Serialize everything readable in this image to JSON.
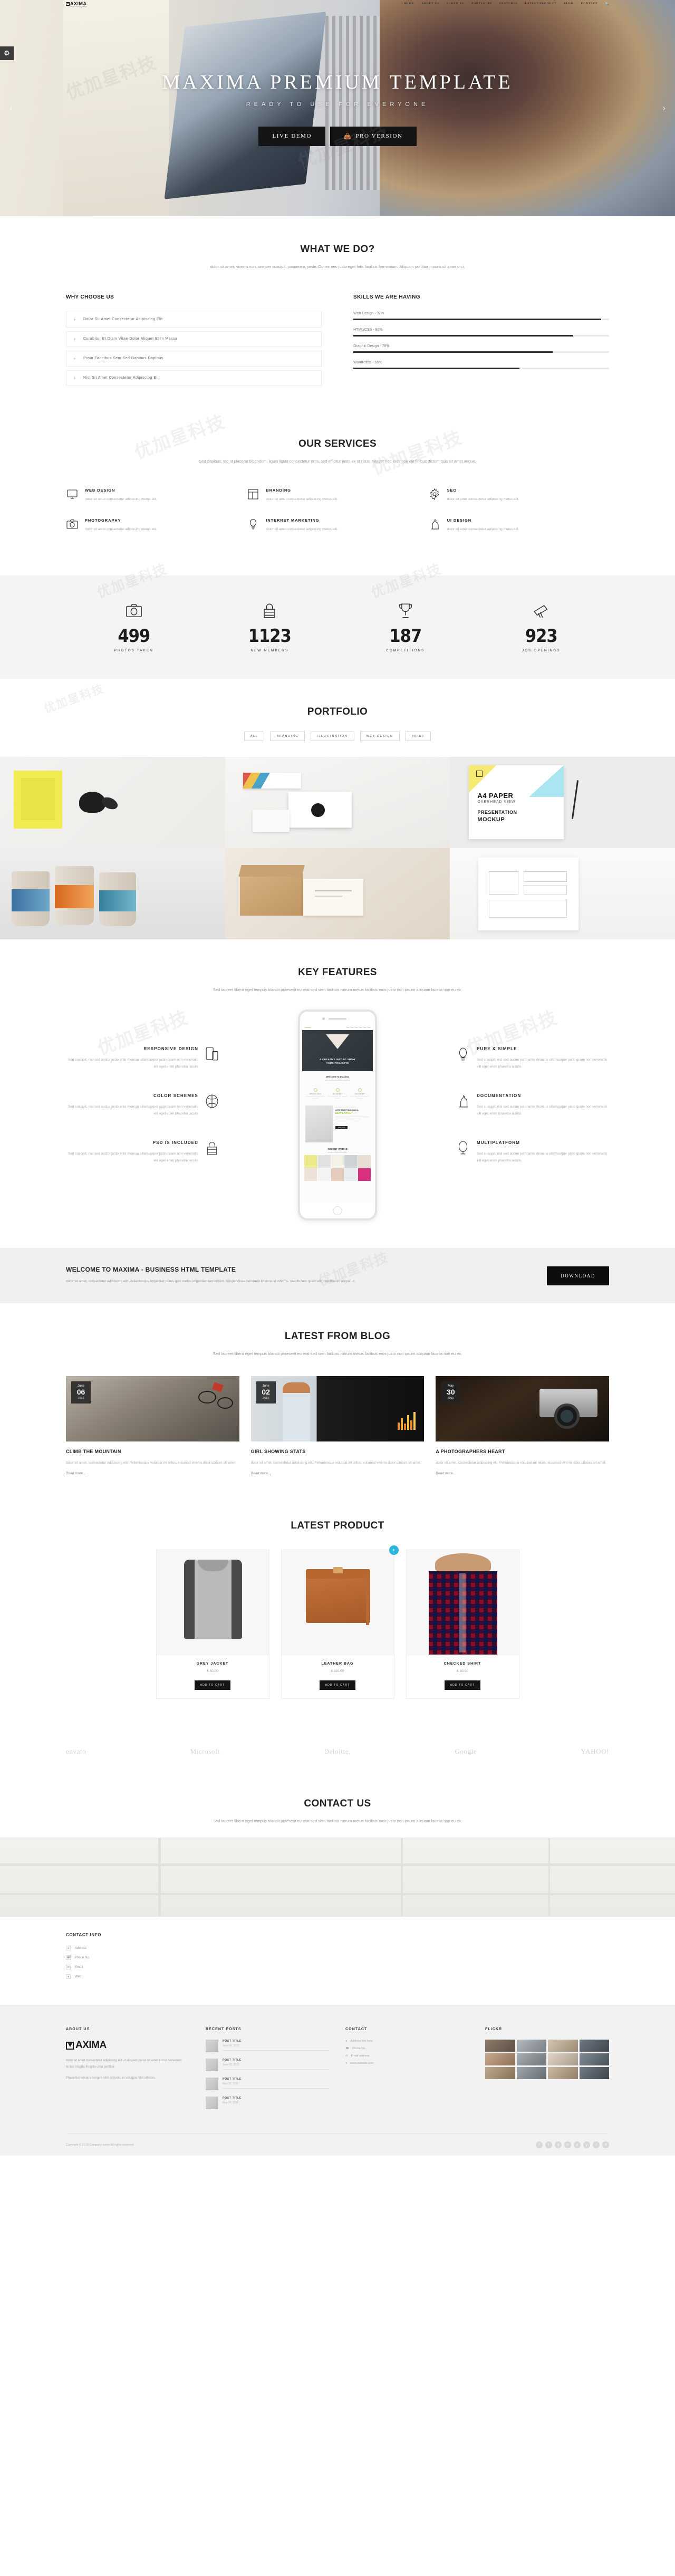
{
  "brand": {
    "name": "AXIMA",
    "full_name": "MAXIMA"
  },
  "nav": {
    "items": [
      "HOME",
      "ABOUT US",
      "SERVICES",
      "PORTFOLIO",
      "FEATURES",
      "LATEST PRODUCT",
      "BLOG",
      "CONTACT"
    ],
    "search_icon": "search-icon"
  },
  "hero": {
    "title": "MAXIMA PREMIUM TEMPLATE",
    "subtitle": "READY TO USE FOR EVERYONE",
    "button_primary": "LIVE DEMO",
    "button_secondary": "PRO VERSION",
    "arrow_left": "‹",
    "arrow_right": "›"
  },
  "what_we_do": {
    "title": "WHAT WE DO?",
    "desc": "dolor sit amet, viverra non, semper suscipit, posuere a, pede. Donec nec justo eget felis facilisis fermentum. Aliquam porttitor mauris sit amet orci.",
    "why_title": "WHY CHOOSE US",
    "why_items": [
      "Dolor Sit Amet Consectetur Adipiscing Elit",
      "Curabitur Et Diam Vitae Dolor Aliquet Et In Massa",
      "Proin Faucibus Sem Sed Dapibus Dapibus",
      "Nisl Sit Amet Consectetur Adipiscing Elit"
    ],
    "skills_title": "SKILLS WE ARE HAVING",
    "skills": [
      {
        "label": "Web Design - 97%",
        "value": 97
      },
      {
        "label": "HTML/CSS - 86%",
        "value": 86
      },
      {
        "label": "Graphic Design - 78%",
        "value": 78
      },
      {
        "label": "WordPress - 65%",
        "value": 65
      }
    ]
  },
  "services": {
    "title": "OUR SERVICES",
    "desc": "Sed dapibus, leo ut placerat bibendum, ligula ligula consectetur eros, sed efficitur justo ex ut risus. Integer nec eros non elit finibus dictum quis sit amet augue.",
    "items": [
      {
        "icon": "monitor-icon",
        "title": "WEB DESIGN",
        "desc": "dolor sit amet consectetur adipiscing metus elit."
      },
      {
        "icon": "layout-icon",
        "title": "BRANDING",
        "desc": "dolor sit amet consectetur adipiscing metus elit."
      },
      {
        "icon": "gear-icon",
        "title": "SEO",
        "desc": "dolor sit amet consectetur adipiscing metus elit."
      },
      {
        "icon": "camera-icon",
        "title": "PHOTOGRAPHY",
        "desc": "dolor sit amet consectetur adipiscing metus elit."
      },
      {
        "icon": "lightbulb-icon",
        "title": "INTERNET MARKETING",
        "desc": "dolor sit amet consectetur adipiscing metus elit."
      },
      {
        "icon": "chess-knight-icon",
        "title": "UI DESIGN",
        "desc": "dolor sit amet consectetur adipiscing metus elit."
      }
    ]
  },
  "counters": [
    {
      "icon": "camera-icon",
      "number": "499",
      "label": "PHOTOS TAKEN"
    },
    {
      "icon": "lock-icon",
      "number": "1123",
      "label": "NEW MEMBERS"
    },
    {
      "icon": "trophy-icon",
      "number": "187",
      "label": "COMPETITIONS"
    },
    {
      "icon": "telescope-icon",
      "number": "923",
      "label": "JOB OPENINGS"
    }
  ],
  "portfolio": {
    "title": "PORTFOLIO",
    "filters": [
      "ALL",
      "BRANDING",
      "ILLUSTRATION",
      "WEB DESIGN",
      "PRINT"
    ],
    "tiles": [
      {
        "name": "sticky-notes-butterfly"
      },
      {
        "name": "business-card-stack"
      },
      {
        "name": "a4-paper-mockup",
        "caption_line1": "A4 PAPER",
        "caption_line2": "OVERHEAD VIEW",
        "caption_line3": "PRESENTATION",
        "caption_line4": "MOCKUP"
      },
      {
        "name": "coffee-cups"
      },
      {
        "name": "kraft-box-cards"
      },
      {
        "name": "blueprint-sketch"
      }
    ]
  },
  "key_features": {
    "title": "KEY FEATURES",
    "desc": "Sed laoreet libero eget tempus blandit praesent eu erat sed sem facilisis rutrum metus facilisis eros justo non ipsum aliquam lacinia non eu ex.",
    "body": "Sed suscipit, nisl sed auctor justo ante rhoncus ullamcorper justo quam non venenatis elit eget enim pharetra iaculis",
    "left": [
      {
        "icon": "devices-icon",
        "title": "RESPONSIVE DESIGN"
      },
      {
        "icon": "color-wheel-icon",
        "title": "COLOR SCHEMES"
      },
      {
        "icon": "lock-icon",
        "title": "PSD IS INCLUDED"
      }
    ],
    "right": [
      {
        "icon": "lightbulb-icon",
        "title": "PURE & SIMPLE"
      },
      {
        "icon": "chess-knight-icon",
        "title": "DOCUMENTATION"
      },
      {
        "icon": "mirror-icon",
        "title": "MULTIPLATFORM"
      }
    ],
    "phone_screen": {
      "logo": "maxima",
      "hero_caption_1": "A CREATIVE WAY TO SHOW",
      "hero_caption_2": "YOUR PROJECTS",
      "welcome_title": "Welcome to maxima",
      "welcome_sub": "dolor sit amet consectetur adipiscing",
      "feature_labels": [
        "BUSINESS IDEAS",
        "WE ARE BEST",
        "CREATIVE WAY"
      ],
      "feature_text": "dolor sit amet consectetur adipiscing elit sed do",
      "promo_top": "CUSTOMIZE YOUR SITE IN MINUTES",
      "promo_h1": "LETS START BUILDING A",
      "promo_h2": "NEW LAYOUT",
      "promo_btn": "READ MORE",
      "works_title": "RECENT WORKS",
      "works_sub": "20 latest projects showcase"
    }
  },
  "cta": {
    "title": "WELCOME TO MAXIMA - BUSINESS HTML TEMPLATE",
    "desc": "dolor sit amet, consectetur adipiscing elit. Pellentesque imperdiet purus quis metus imperdiet fermentum. Suspendisse hendrerit id lacus id lobortis. Vestibulum quam elit, dapibus ac augue ut.",
    "button": "DOWNLOAD"
  },
  "blog": {
    "title": "LATEST FROM BLOG",
    "desc": "Sed laoreet libero eget tempus blandit praesent eu erat sed sem facilisis rutrum metus facilisis eros justo non ipsum aliquam lacinia non eu ex.",
    "posts": [
      {
        "month": "June",
        "day": "06",
        "year": "2015",
        "title": "CLIMB THE MOUNTAIN",
        "excerpt": "dolor sit amet, consectetur adipiscing elit. Pellentesque volutpat mi tellus, euismod viverra dolor ultrices sit amet.",
        "more": "Read more...",
        "thumb": "mountain-biker"
      },
      {
        "month": "June",
        "day": "02",
        "year": "2015",
        "title": "GIRL SHOWING STATS",
        "excerpt": "dolor sit amet, consectetur adipiscing elit. Pellentesque volutpat mi tellus, euismod viverra dolor ultrices sit amet.",
        "more": "Read more...",
        "thumb": "girl-presenting-chart"
      },
      {
        "month": "May",
        "day": "30",
        "year": "2015",
        "title": "A PHOTOGRAPHERS HEART",
        "excerpt": "dolor sit amet, consectetur adipiscing elit. Pellentesque volutpat mi tellus, euismod viverra dolor ultrices sit amet.",
        "more": "Read more...",
        "thumb": "vintage-camera"
      }
    ]
  },
  "products": {
    "title": "LATEST PRODUCT",
    "items": [
      {
        "name": "GREY JACKET",
        "price": "£ 50.00",
        "button": "ADD TO CART",
        "image": "grey-jacket",
        "badge": ""
      },
      {
        "name": "LEATHER BAG",
        "price": "£ 110.00",
        "button": "ADD TO CART",
        "image": "leather-bag",
        "badge": "+"
      },
      {
        "name": "CHECKED SHIRT",
        "price": "£ 30.00",
        "button": "ADD TO CART",
        "image": "checked-shirt",
        "badge": ""
      }
    ]
  },
  "clients": [
    "envato",
    "Microsoft",
    "Deloitte.",
    "Google",
    "YAHOO!"
  ],
  "contact": {
    "title": "CONTACT US",
    "desc": "Sed laoreet libero eget tempus blandit praesent eu erat sed sem facilisis rutrum metus facilisis eros justo non ipsum aliquam lacinia non eu ex.",
    "info_title": "CONTACT INFO",
    "items": [
      {
        "icon": "location-icon",
        "text": "Address"
      },
      {
        "icon": "phone-icon",
        "text": "Phone No."
      },
      {
        "icon": "mail-icon",
        "text": "Email"
      },
      {
        "icon": "globe-icon",
        "text": "Web"
      }
    ]
  },
  "footer": {
    "about_title": "ABOUT US",
    "about_text_1": "dolor sit amet consectetur adipiscing elit ut aliquam purus sit amet luctus venenatis lectus magna fringilla urna porttitor.",
    "about_text_2": "Phasellus tempus congue nibh tempus, et volutpat nibh ultricies.",
    "recent_title": "RECENT POSTS",
    "recent_posts": [
      {
        "title": "POST TITLE",
        "date": "June 06, 2015"
      },
      {
        "title": "POST TITLE",
        "date": "June 02, 2015"
      },
      {
        "title": "POST TITLE",
        "date": "May 30, 2015"
      },
      {
        "title": "POST TITLE",
        "date": "May 24, 2015"
      }
    ],
    "contact_title": "CONTACT",
    "contact_items": [
      "Address line here",
      "Phone No.",
      "Email address",
      "www.website.com"
    ],
    "flickr_title": "FLICKR",
    "copyright": "Copyright © 2015 Company name All rights reserved.",
    "socials": [
      "f",
      "t",
      "g",
      "in",
      "p",
      "y",
      "r",
      "d"
    ]
  },
  "settings_icon": "gear-icon",
  "watermark": "优加星科技"
}
